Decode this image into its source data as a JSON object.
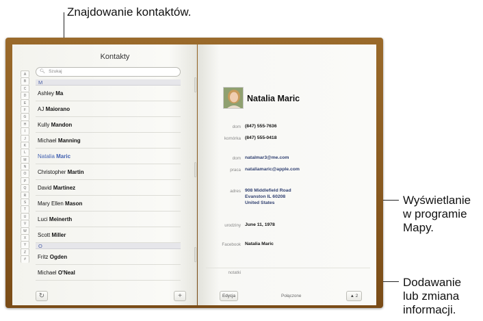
{
  "callouts": {
    "find_contacts": "Znajdowanie kontaktów.",
    "maps_line1": "Wyświetlanie",
    "maps_line2": "w programie",
    "maps_line3": "Mapy.",
    "edit_line1": "Dodawanie",
    "edit_line2": "lub zmiana",
    "edit_line3": "informacji."
  },
  "left_page": {
    "title": "Kontakty",
    "search_placeholder": "Szukaj",
    "index_letters": [
      "A",
      "B",
      "C",
      "D",
      "E",
      "F",
      "G",
      "H",
      "I",
      "J",
      "K",
      "L",
      "M",
      "N",
      "O",
      "P",
      "Q",
      "R",
      "S",
      "T",
      "U",
      "V",
      "W",
      "X",
      "Y",
      "Z",
      "#"
    ],
    "sections": [
      {
        "letter": "M",
        "rows": [
          {
            "first": "Ashley",
            "last": "Ma"
          },
          {
            "first": "AJ",
            "last": "Maiorano"
          },
          {
            "first": "Kully",
            "last": "Mandon"
          },
          {
            "first": "Michael",
            "last": "Manning"
          },
          {
            "first": "Natalia",
            "last": "Maric",
            "selected": true
          },
          {
            "first": "Christopher",
            "last": "Martin"
          },
          {
            "first": "David",
            "last": "Martinez"
          },
          {
            "first": "Mary Ellen",
            "last": "Mason"
          },
          {
            "first": "Luci",
            "last": "Meinerth"
          },
          {
            "first": "Scott",
            "last": "Miller"
          }
        ]
      },
      {
        "letter": "O",
        "rows": [
          {
            "first": "Fritz",
            "last": "Ogden"
          },
          {
            "first": "Michael",
            "last": "O'Neal"
          }
        ]
      }
    ],
    "refresh_icon": "↻",
    "add_icon": "+"
  },
  "right_page": {
    "name": "Natalia Maric",
    "fields": {
      "home_phone_label": "dom",
      "home_phone": "(847) 555-7636",
      "mobile_label": "komórka",
      "mobile": "(847) 555-0418",
      "home_email_label": "dom",
      "home_email": "natalmar3@me.com",
      "work_email_label": "praca",
      "work_email": "nataliamaric@apple.com",
      "address_label": "adres",
      "address_line1": "908 Middlefield Road",
      "address_line2": "Evanston IL 60208",
      "address_line3": "United States",
      "birthday_label": "urodziny",
      "birthday": "June 11, 1978",
      "facebook_label": "Facebook",
      "facebook": "Natalia Maric",
      "notes_label": "notatki"
    },
    "edit_label": "Edycja",
    "linked_label": "Połączone",
    "share_label": "2"
  },
  "colors": {
    "leather": "#8a5a20",
    "page": "#f7f7f4",
    "selected": "#3f5fb0",
    "section_header": "#e6e6ea"
  }
}
